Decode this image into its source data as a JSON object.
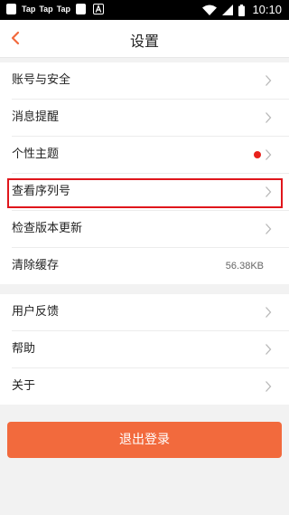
{
  "statusbar": {
    "notifications": [
      "Tap",
      "Tap",
      "Tap"
    ],
    "time": "10:10"
  },
  "header": {
    "title": "设置"
  },
  "groups": [
    {
      "items": [
        {
          "label": "账号与安全"
        },
        {
          "label": "消息提醒"
        },
        {
          "label": "个性主题",
          "badge": "red-dot"
        },
        {
          "label": "查看序列号",
          "highlighted": true
        },
        {
          "label": "检查版本更新"
        },
        {
          "label": "清除缓存",
          "value": "56.38KB"
        }
      ]
    },
    {
      "items": [
        {
          "label": "用户反馈"
        },
        {
          "label": "帮助"
        },
        {
          "label": "关于"
        }
      ]
    }
  ],
  "logout": {
    "label": "退出登录"
  },
  "colors": {
    "accent": "#f26a3d",
    "highlight_border": "#e0161c",
    "badge": "#e8211c",
    "background": "#f2f2f2"
  }
}
